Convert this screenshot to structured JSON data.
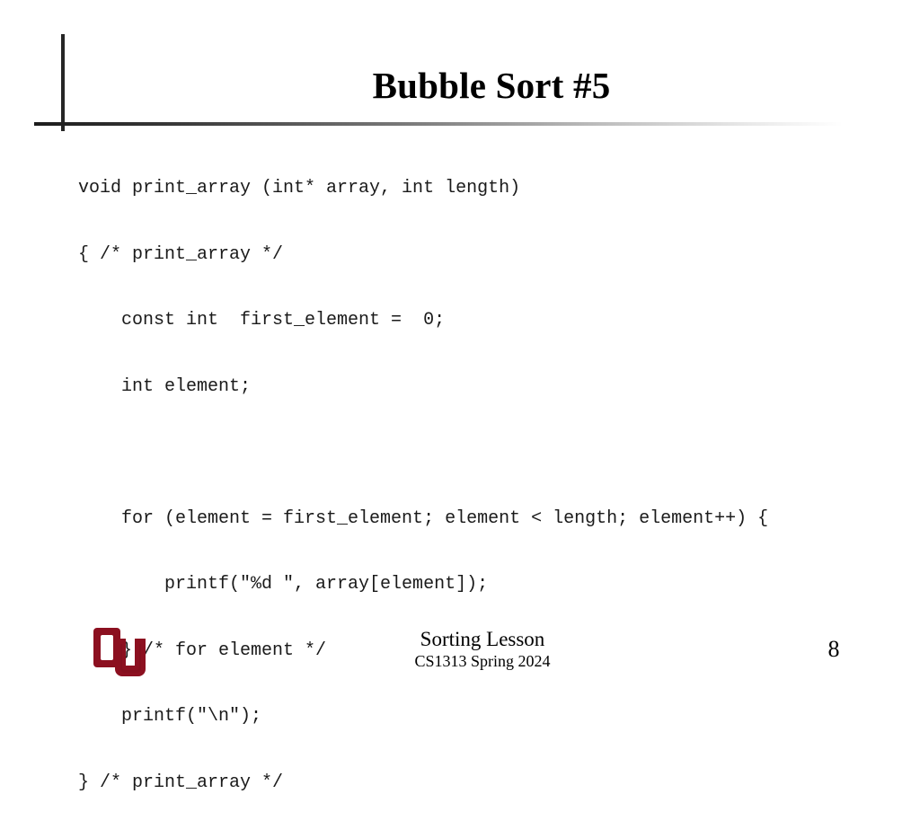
{
  "slide": {
    "title": "Bubble Sort #5",
    "code_lines": [
      "void print_array (int* array, int length)",
      "{ /* print_array */",
      "    const int  first_element =  0;",
      "    int element;",
      "",
      "    for (element = first_element; element < length; element++) {",
      "        printf(\"%d \", array[element]);",
      "    } /* for element */",
      "    printf(\"\\n\");",
      "} /* print_array */"
    ],
    "footer": {
      "lesson": "Sorting Lesson",
      "course": "CS1313 Spring 2024",
      "page_number": "8",
      "logo_alt": "OU"
    },
    "colors": {
      "logo_crimson": "#8c1020",
      "logo_crimson_dark": "#6e0c18",
      "rule_dark": "#1c1c1c",
      "text": "#000000",
      "code_text": "#1a1a1a",
      "background": "#ffffff"
    }
  }
}
